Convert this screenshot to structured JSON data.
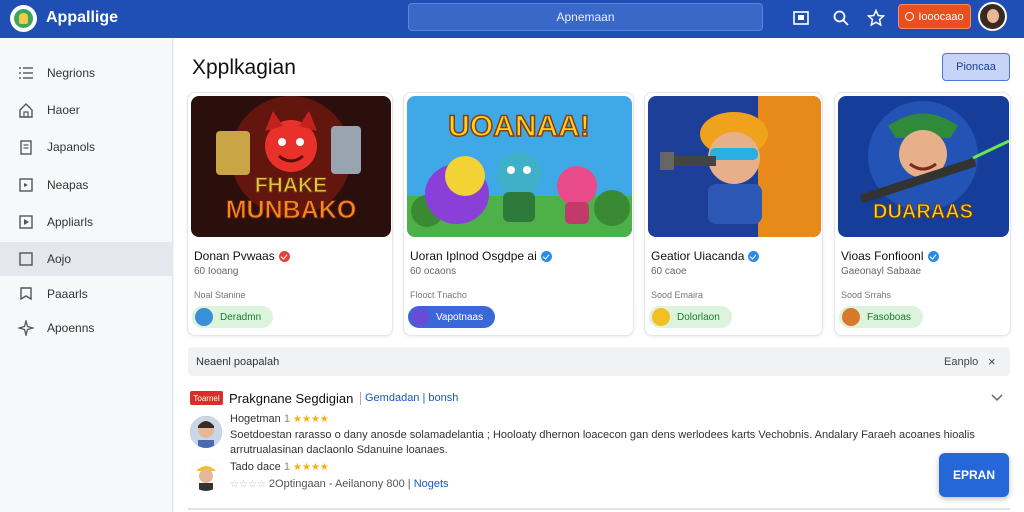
{
  "app": {
    "title": "Appallige",
    "search_text": "Apnemaan"
  },
  "topbar": {
    "action_label": "Iooocaao"
  },
  "sidebar": {
    "items": [
      {
        "label": "Negrions",
        "icon": "list-icon"
      },
      {
        "label": "Haoer",
        "icon": "home-icon"
      },
      {
        "label": "Japanols",
        "icon": "clipboard-icon"
      },
      {
        "label": "Neapas",
        "icon": "square-icon"
      },
      {
        "label": "Appliarls",
        "icon": "play-square-icon"
      },
      {
        "label": "Aojo",
        "icon": "square-icon",
        "active": true
      },
      {
        "label": "Paaarls",
        "icon": "bookmark-icon"
      },
      {
        "label": "Apoenns",
        "icon": "sparkle-icon"
      }
    ]
  },
  "main": {
    "title": "Xpplkagian",
    "top_button": "Pioncaa",
    "cards": [
      {
        "name": "Donan Pvwaas",
        "sub": "60 Iooang",
        "meta": "Noal Stanine",
        "pill": "Deradmn",
        "art_title_1": "FHAKE",
        "art_title_2": "MUNBAKO",
        "badge_color": "#e0453a",
        "pill_bg": "#dcf3dc",
        "pill_fg": "#1d7a2f"
      },
      {
        "name": "Uoran Iplnod Osgdpe ai",
        "sub": "60 ocaons",
        "meta": "Flooct Tnacho",
        "pill": "Vapotnaas",
        "art_title_1": "UOANAA!",
        "art_title_2": "",
        "badge_color": "#2b8ce8",
        "pill_bg": "#3b68d8",
        "pill_fg": "#ffffff"
      },
      {
        "name": "Geatior Uiacanda",
        "sub": "60 caoe",
        "meta": "Sood Emaira",
        "pill": "Dolorlaon",
        "art_title_1": "",
        "art_title_2": "",
        "badge_color": "#2b8ce8",
        "pill_bg": "#dcf3dc",
        "pill_fg": "#1d7a2f"
      },
      {
        "name": "Vioas Fonfioonl",
        "sub": "Gaeonayl Sabaae",
        "meta": "Sood Srrahs",
        "pill": "Fasoboas",
        "art_title_1": "DUARAAS",
        "art_title_2": "",
        "badge_color": "#2b8ce8",
        "pill_bg": "#dcf3dc",
        "pill_fg": "#1d7a2f"
      }
    ],
    "notice": {
      "text": "Neaenl poapalah",
      "link": "Eanplo",
      "close": "×"
    },
    "review": {
      "tag": "Toarnel",
      "title": "Prakgnane Segdigian",
      "link": "Gemdadan | bonsh",
      "user1": "Hogetman",
      "user2": "Tado dace",
      "user2_num": "1",
      "body": "Soetdoestan rarasso o dany anosde solamadelantia ; Hooloaty dhernon loacecon gan dens werlodees karts Vechobnis. Andalary Faraeh acoanes hioalis arrutrualasinan  daclaonlo  Sdanuine loanaes.",
      "foot_text": "2Optingaan - Aeilanony  800",
      "foot_sep": "|",
      "foot_link": "Nogets"
    },
    "fab_label": "EPRAN"
  },
  "colors": {
    "topbar": "#1f4fb4",
    "accent": "#2566d8",
    "action": "#e8501f"
  }
}
